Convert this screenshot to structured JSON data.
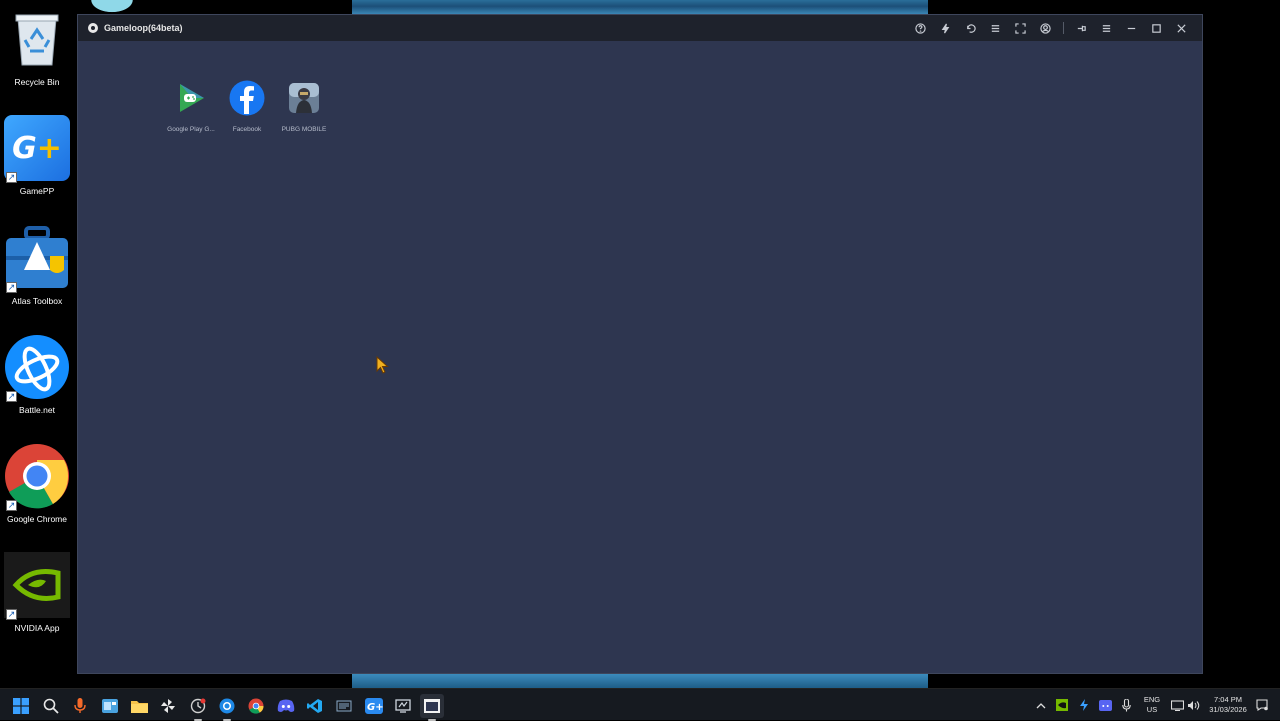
{
  "desktop": {
    "icons": [
      {
        "label": "Recycle Bin",
        "icon": "recycle-bin-icon"
      },
      {
        "label": "GamePP",
        "icon": "gamepp-icon"
      },
      {
        "label": "Atlas Toolbox",
        "icon": "atlas-toolbox-icon"
      },
      {
        "label": "Battle.net",
        "icon": "battle-net-icon"
      },
      {
        "label": "Google Chrome",
        "icon": "chrome-icon"
      },
      {
        "label": "NVIDIA App",
        "icon": "nvidia-icon"
      }
    ]
  },
  "window": {
    "title": "Gameloop(64beta)",
    "toolbar": [
      "help-icon",
      "boost-icon",
      "back-icon",
      "list-icon",
      "fullscreen-icon",
      "account-icon",
      "pin-icon",
      "menu-icon",
      "minimize-icon",
      "maximize-icon",
      "close-icon"
    ],
    "apps": [
      {
        "label": "Google Play G...",
        "icon": "google-play-games-icon",
        "color": "#34a853"
      },
      {
        "label": "Facebook",
        "icon": "facebook-icon",
        "color": "#1877f2"
      },
      {
        "label": "PUBG MOBILE",
        "icon": "pubg-mobile-icon",
        "color": "#8fa3b8"
      }
    ]
  },
  "taskbar": {
    "items": [
      "start-icon",
      "search-icon",
      "microphone-icon",
      "widgets-icon",
      "file-explorer-icon",
      "pinwheel-icon",
      "clock-app-icon",
      "edge-icon",
      "chrome-icon",
      "discord-icon",
      "vscode-icon",
      "notes-icon",
      "gamepp-icon",
      "screen-tool-icon",
      "gameloop-icon"
    ],
    "tray": {
      "language_line1": "ENG",
      "language_line2": "US",
      "time": "7:04 PM",
      "date": "31/03/2026"
    }
  }
}
